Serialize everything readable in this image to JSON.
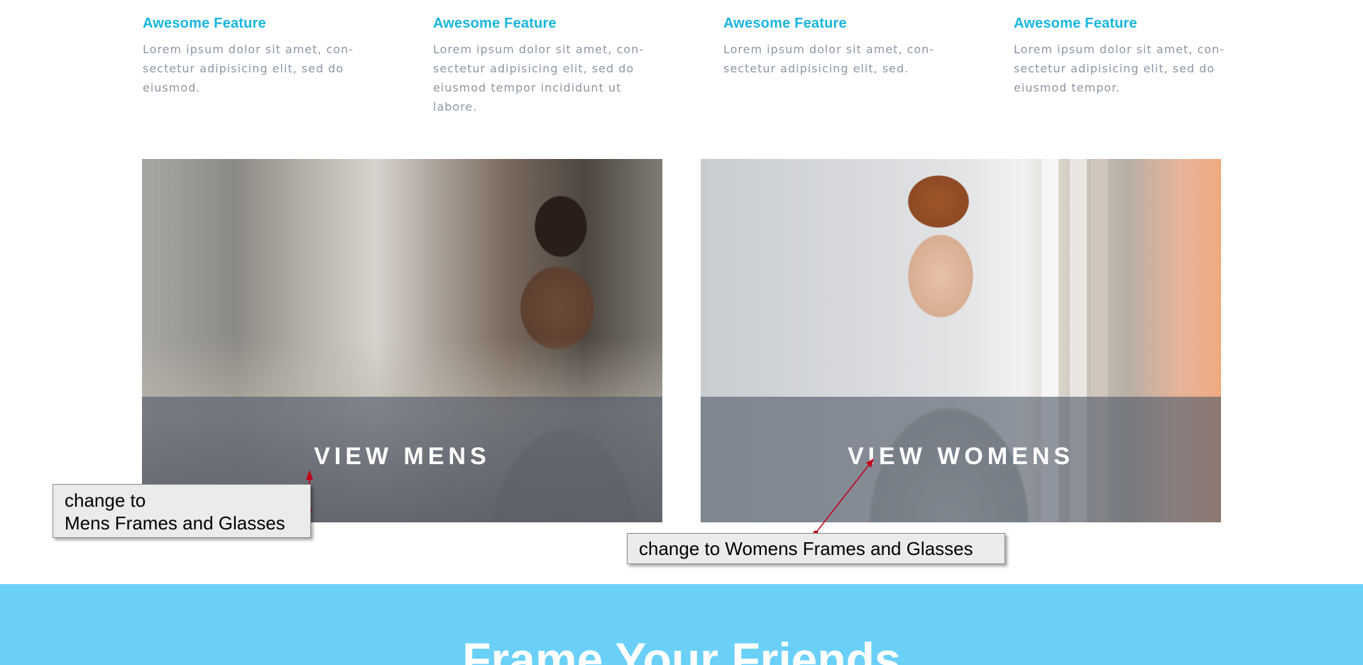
{
  "features": [
    {
      "title": "Awesome Feature",
      "text": "Lorem ipsum dolor sit amet, con-sectetur adipisicing elit, sed do eiusmod."
    },
    {
      "title": "Awesome Feature",
      "text": "Lorem ipsum dolor sit amet, con-sectetur adipisicing elit, sed do eiusmod tempor incididunt ut labore."
    },
    {
      "title": "Awesome Feature",
      "text": "Lorem ipsum dolor sit amet, con-sectetur adipisicing elit, sed."
    },
    {
      "title": "Awesome Feature",
      "text": "Lorem ipsum dolor sit amet, con-sectetur adipisicing elit, sed do eiusmod tempor."
    }
  ],
  "tiles": {
    "mens": {
      "label": "VIEW MENS"
    },
    "womens": {
      "label": "VIEW WOMENS"
    }
  },
  "annotations": {
    "mens_line1": "change to",
    "mens_line2": "Mens Frames and Glasses",
    "womens": "change to Womens Frames and Glasses"
  },
  "banner": {
    "title": "Frame Your Friends"
  },
  "colors": {
    "accent": "#17b6df",
    "banner": "#6bd0f8",
    "body_text": "#8c97a3",
    "annotation_line": "#c0001a"
  }
}
